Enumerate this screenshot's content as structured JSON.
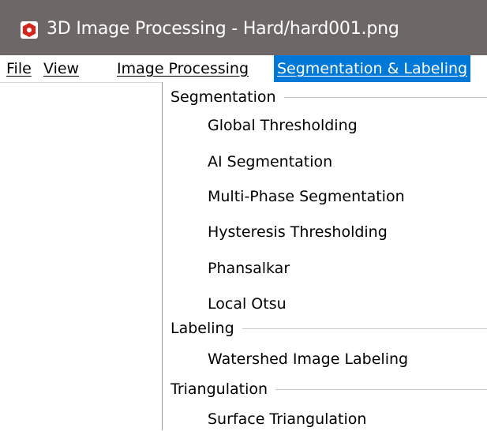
{
  "window": {
    "title": "3D Image Processing - Hard/hard001.png",
    "icon": "app-logo-icon"
  },
  "menubar": {
    "items": [
      {
        "label": "File"
      },
      {
        "label": "View"
      },
      {
        "label": "Image Processing"
      },
      {
        "label": "Segmentation & Labeling",
        "active": true
      }
    ]
  },
  "dropdown": {
    "sections": [
      {
        "label": "Segmentation",
        "items": [
          "Global Thresholding",
          "AI Segmentation",
          "Multi-Phase Segmentation",
          "Hysteresis Thresholding",
          "Phansalkar",
          "Local Otsu"
        ]
      },
      {
        "label": "Labeling",
        "items": [
          "Watershed Image Labeling"
        ]
      },
      {
        "label": "Triangulation",
        "items": [
          "Surface Triangulation"
        ]
      }
    ]
  },
  "colors": {
    "titlebar": "#6e6767",
    "accent": "#0078d7",
    "icon_red": "#d4241c"
  }
}
